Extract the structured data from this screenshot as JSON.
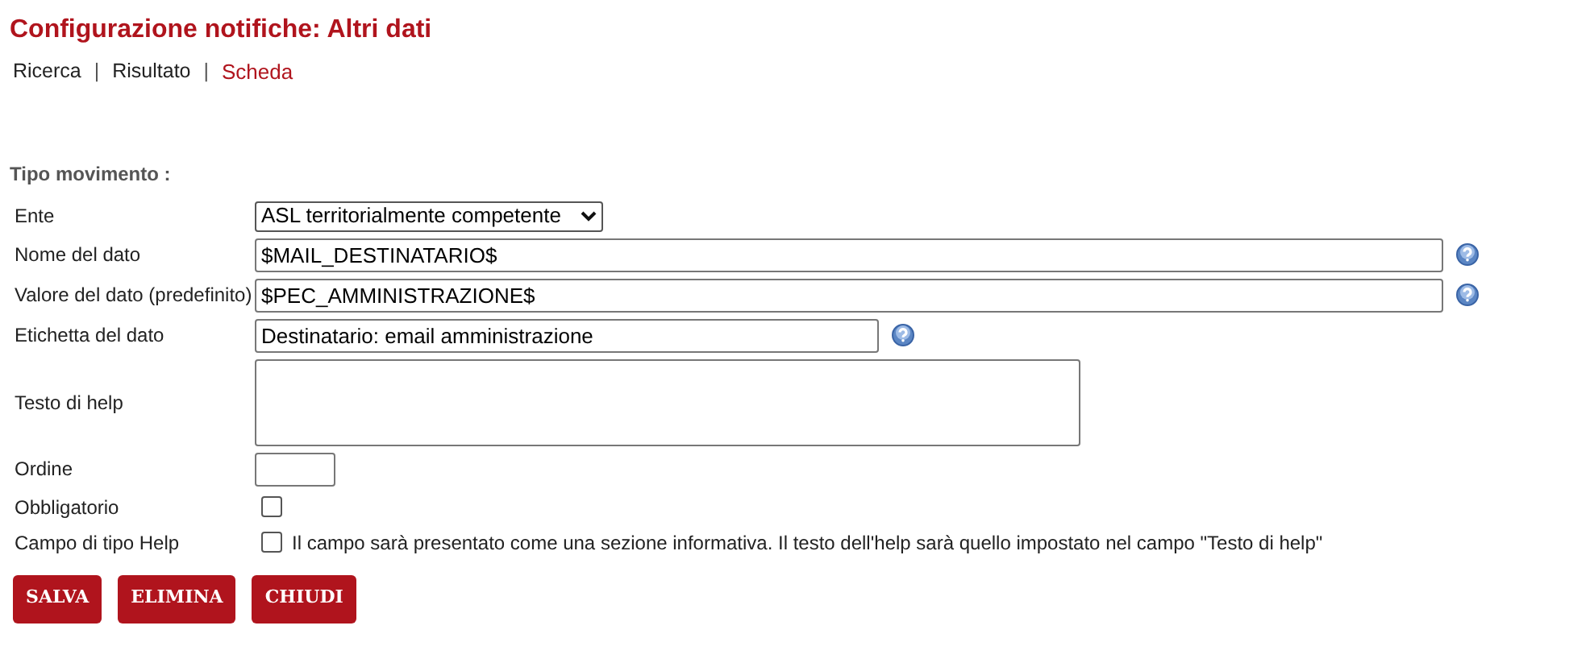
{
  "title": "Configurazione notifiche: Altri dati",
  "breadcrumb": [
    {
      "label": "Ricerca",
      "selected": false
    },
    {
      "kind": "separator",
      "label": "|"
    },
    {
      "label": "Risultato",
      "selected": false
    },
    {
      "kind": "separator",
      "label": "|"
    },
    {
      "label": "Scheda",
      "selected": true
    }
  ],
  "section_label": "Tipo movimento :",
  "fields": [
    {
      "kind": "select",
      "label": "Ente",
      "value": "ASL territorialmente competente",
      "help": false
    },
    {
      "kind": "longtext",
      "label": "Nome del dato",
      "value": "$MAIL_DESTINATARIO$",
      "help": true
    },
    {
      "kind": "longtext",
      "label": "Valore del dato (predefinito)",
      "value": "$PEC_AMMINISTRAZIONE$",
      "help": true
    },
    {
      "kind": "text",
      "label": "Etichetta del dato",
      "value": "Destinatario: email amministrazione",
      "help": true
    },
    {
      "kind": "textarea",
      "label": "Testo di help",
      "help": false
    },
    {
      "kind": "number",
      "label": "Ordine",
      "help": false
    },
    {
      "kind": "checkbox",
      "label": "Obbligatorio",
      "checked": false
    },
    {
      "kind": "checkbox",
      "label": "Campo di tipo Help",
      "checked": false,
      "note": "Il campo sarà presentato come una sezione informativa. Il testo dell'help sarà quello impostato nel campo \"Testo di help\""
    }
  ],
  "buttons": [
    "SALVA",
    "ELIMINA",
    "CHIUDI"
  ]
}
